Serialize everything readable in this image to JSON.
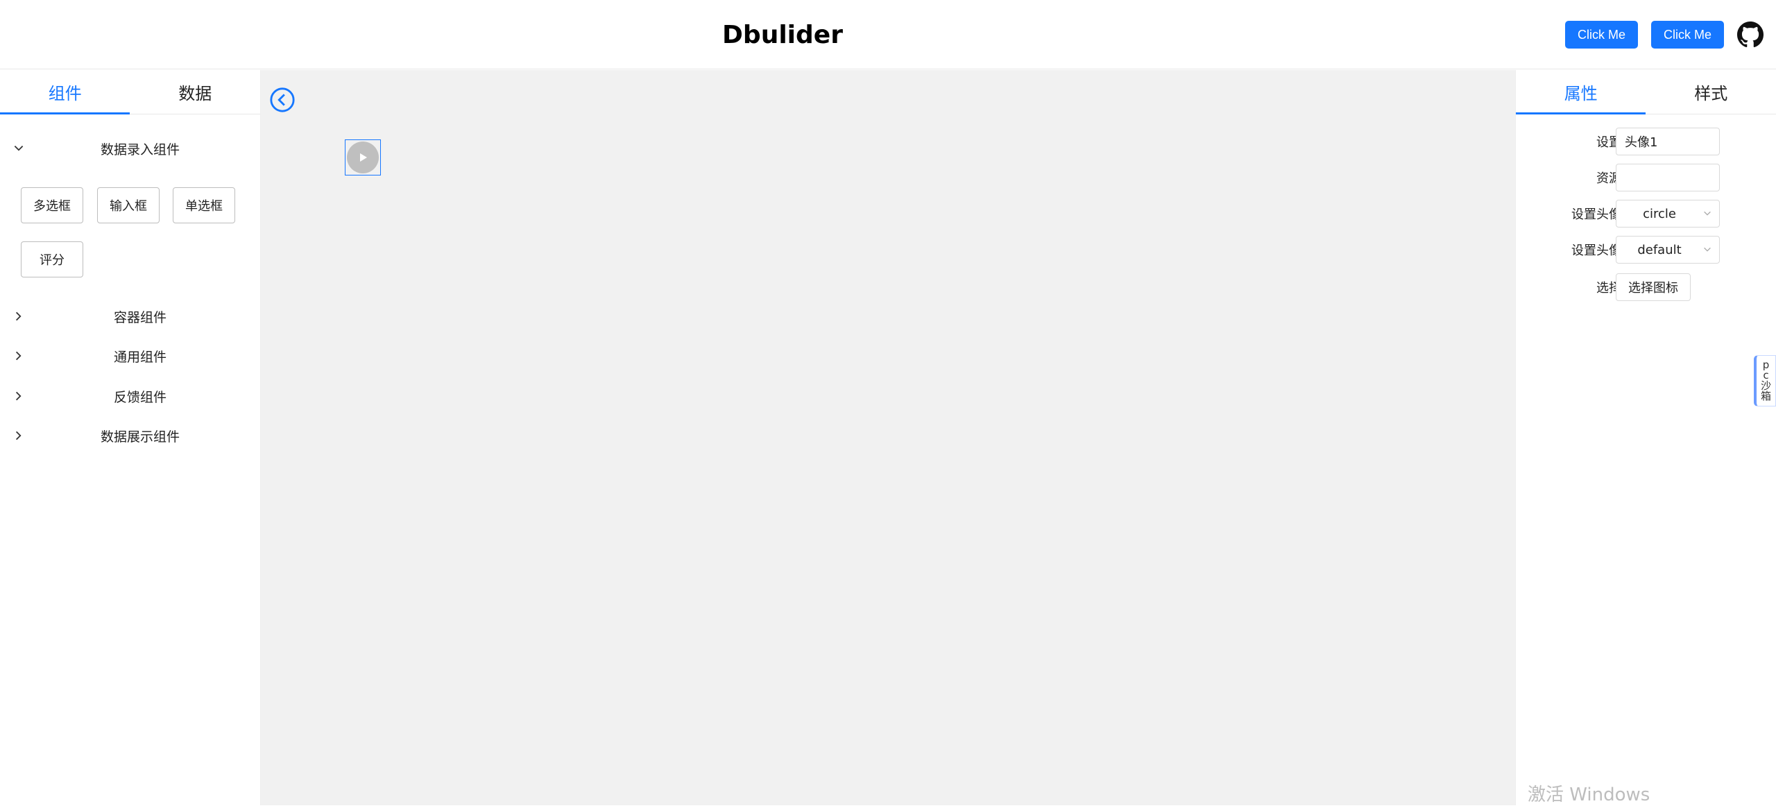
{
  "header": {
    "title": "Dbulider",
    "buttons": [
      "Click Me",
      "Click Me"
    ],
    "github_icon": "github-icon"
  },
  "left_panel": {
    "tabs": [
      {
        "label": "组件",
        "active": true
      },
      {
        "label": "数据",
        "active": false
      }
    ],
    "groups": [
      {
        "label": "数据录入组件",
        "expanded": true,
        "items": [
          "多选框",
          "输入框",
          "单选框",
          "评分"
        ]
      },
      {
        "label": "容器组件",
        "expanded": false
      },
      {
        "label": "通用组件",
        "expanded": false
      },
      {
        "label": "反馈组件",
        "expanded": false
      },
      {
        "label": "数据展示组件",
        "expanded": false
      }
    ]
  },
  "canvas": {
    "back_icon": "chevron-left-circle-icon",
    "selected_component_icon": "play-icon"
  },
  "right_panel": {
    "tabs": [
      {
        "label": "属性",
        "active": true
      },
      {
        "label": "样式",
        "active": false
      }
    ],
    "props": {
      "title_label": "设置标题",
      "title_value": "头像1",
      "src_label": "资源地址",
      "src_value": "",
      "shape_label": "设置头像形状",
      "shape_value": "circle",
      "size_label": "设置头像大小",
      "size_value": "default",
      "icon_label": "选择图标",
      "icon_button": "选择图标"
    }
  },
  "sandbox_tab": {
    "chars": [
      "p",
      "c",
      "沙",
      "箱"
    ]
  },
  "watermark": "激活 Windows",
  "colors": {
    "accent": "#1677ff",
    "canvas_bg": "#f1f1f1"
  }
}
